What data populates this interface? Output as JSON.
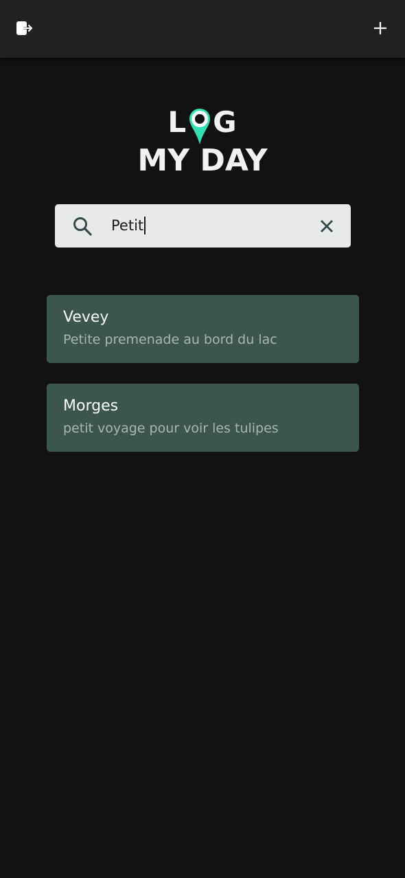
{
  "header": {
    "logout_icon": "logout-icon",
    "add_icon": "plus-icon"
  },
  "logo": {
    "line1_left": "L",
    "line1_right": "G",
    "line2": "MY DAY",
    "pin_color": "#2fe0b0"
  },
  "search": {
    "value": "Petit",
    "icon": "search-icon",
    "clear_icon": "close-icon"
  },
  "results": [
    {
      "title": "Vevey",
      "description": "Petite premenade au bord du lac"
    },
    {
      "title": "Morges",
      "description": "petit voyage pour voir les tulipes"
    }
  ],
  "colors": {
    "background": "#121212",
    "topbar": "#212121",
    "card": "#3c554e",
    "search_bg": "#e8eae9"
  }
}
